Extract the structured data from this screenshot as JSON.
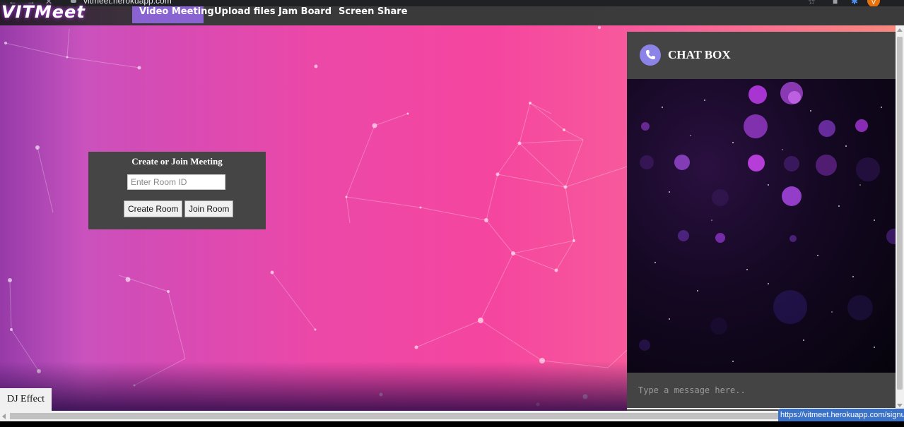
{
  "browser": {
    "url": "vitmeet.herokuapp.com",
    "avatar_letter": "V",
    "status_url": "https://vitmeet.herokuapp.com/signup"
  },
  "site": {
    "logo": "VITMeet",
    "nav": [
      {
        "label": "Video Meeting",
        "active": true
      },
      {
        "label": "Upload files",
        "active": false
      },
      {
        "label": "Jam Board",
        "active": false
      },
      {
        "label": "Screen Share",
        "active": false
      }
    ]
  },
  "meeting": {
    "title": "Create or Join Meeting",
    "room_placeholder": "Enter Room ID",
    "create_label": "Create Room",
    "join_label": "Join Room"
  },
  "chat": {
    "title": "CHAT BOX",
    "input_placeholder": "Type a message here.."
  },
  "dj_effect": "DJ Effect",
  "colors": {
    "nav_active": "#8a63d2",
    "panel": "#454545",
    "chat_icon": "#8b83e8",
    "status_bar": "#3a72c9"
  }
}
